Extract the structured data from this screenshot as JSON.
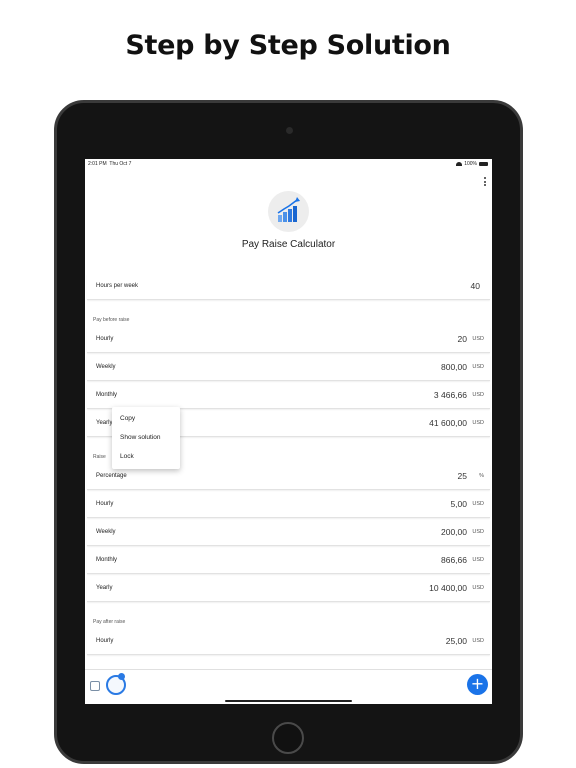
{
  "headline": "Step by Step Solution",
  "status": {
    "time": "2:01 PM",
    "date": "Thu Oct 7",
    "battery": "100%"
  },
  "app": {
    "title": "Pay Raise Calculator"
  },
  "hours": {
    "label": "Hours per week",
    "value": "40"
  },
  "sections": {
    "before": "Pay before raise",
    "raise": "Raise",
    "after": "Pay after raise"
  },
  "before_rows": [
    {
      "label": "Hourly",
      "value": "20",
      "unit": "USD"
    },
    {
      "label": "Weekly",
      "value": "800,00",
      "unit": "USD"
    },
    {
      "label": "Monthly",
      "value": "3 466,66",
      "unit": "USD"
    },
    {
      "label": "Yearly",
      "value": "41 600,00",
      "unit": "USD"
    }
  ],
  "raise_rows": [
    {
      "label": "Percentage",
      "value": "25",
      "unit": "%"
    },
    {
      "label": "Hourly",
      "value": "5,00",
      "unit": "USD"
    },
    {
      "label": "Weekly",
      "value": "200,00",
      "unit": "USD"
    },
    {
      "label": "Monthly",
      "value": "866,66",
      "unit": "USD"
    },
    {
      "label": "Yearly",
      "value": "10 400,00",
      "unit": "USD"
    }
  ],
  "after_rows": [
    {
      "label": "Hourly",
      "value": "25,00",
      "unit": "USD"
    }
  ],
  "context_menu": {
    "copy": "Copy",
    "show_solution": "Show solution",
    "lock": "Lock"
  },
  "fab": {
    "label": "+"
  },
  "colors": {
    "accent": "#1a73e8"
  }
}
